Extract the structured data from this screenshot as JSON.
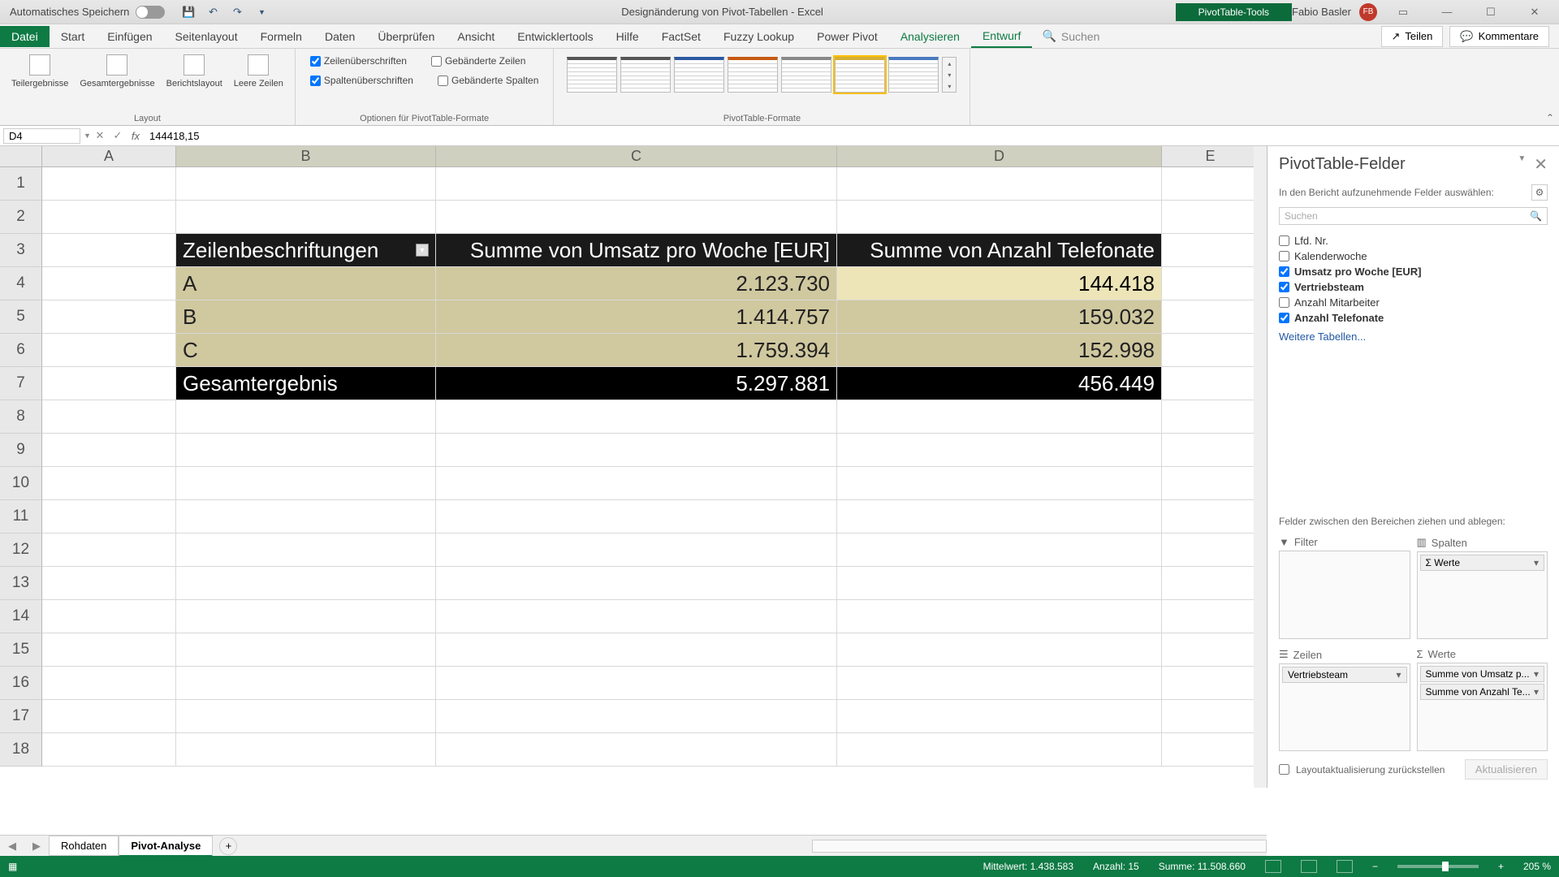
{
  "titlebar": {
    "autosave": "Automatisches Speichern",
    "doc_title": "Designänderung von Pivot-Tabellen - Excel",
    "tools_tab": "PivotTable-Tools",
    "user": "Fabio Basler",
    "user_initials": "FB"
  },
  "ribbon": {
    "tabs": [
      "Datei",
      "Start",
      "Einfügen",
      "Seitenlayout",
      "Formeln",
      "Daten",
      "Überprüfen",
      "Ansicht",
      "Entwicklertools",
      "Hilfe",
      "FactSet",
      "Fuzzy Lookup",
      "Power Pivot",
      "Analysieren",
      "Entwurf"
    ],
    "search_label": "Suchen",
    "share": "Teilen",
    "comments": "Kommentare",
    "layout_group": "Layout",
    "layout_btn1": "Teilergebnisse",
    "layout_btn2": "Gesamtergebnisse",
    "layout_btn3": "Berichtslayout",
    "layout_btn4": "Leere Zeilen",
    "opt_group": "Optionen für PivotTable-Formate",
    "chk_row_hdr": "Zeilenüberschriften",
    "chk_col_hdr": "Spaltenüberschriften",
    "chk_band_rows": "Gebänderte Zeilen",
    "chk_band_cols": "Gebänderte Spalten",
    "styles_group": "PivotTable-Formate"
  },
  "namebox": "D4",
  "formula": "144418,15",
  "columns": {
    "A_w": 165,
    "B_w": 320,
    "C_w": 494,
    "D_w": 400,
    "E_w": 120
  },
  "pivot": {
    "hdr_rows": "Zeilenbeschriftungen",
    "hdr_c": "Summe von Umsatz pro Woche [EUR]",
    "hdr_d": "Summe von Anzahl Telefonate",
    "rows": [
      {
        "label": "A",
        "c": "2.123.730",
        "d": "144.418"
      },
      {
        "label": "B",
        "c": "1.414.757",
        "d": "159.032"
      },
      {
        "label": "C",
        "c": "1.759.394",
        "d": "152.998"
      }
    ],
    "total_label": "Gesamtergebnis",
    "total_c": "5.297.881",
    "total_d": "456.449"
  },
  "fieldpane": {
    "title": "PivotTable-Felder",
    "subtitle": "In den Bericht aufzunehmende Felder auswählen:",
    "search_ph": "Suchen",
    "fields": [
      {
        "checked": false,
        "label": "Lfd. Nr."
      },
      {
        "checked": false,
        "label": "Kalenderwoche"
      },
      {
        "checked": true,
        "label": "Umsatz pro Woche [EUR]"
      },
      {
        "checked": true,
        "label": "Vertriebsteam"
      },
      {
        "checked": false,
        "label": "Anzahl Mitarbeiter"
      },
      {
        "checked": true,
        "label": "Anzahl Telefonate"
      }
    ],
    "more_tables": "Weitere Tabellen...",
    "drag_label": "Felder zwischen den Bereichen ziehen und ablegen:",
    "area_filter": "Filter",
    "area_cols": "Spalten",
    "area_rows": "Zeilen",
    "area_values": "Werte",
    "col_item": "Σ Werte",
    "row_item": "Vertriebsteam",
    "val_item1": "Summe von Umsatz p...",
    "val_item2": "Summe von Anzahl Te...",
    "defer": "Layoutaktualisierung zurückstellen",
    "update": "Aktualisieren"
  },
  "tabs": {
    "t1": "Rohdaten",
    "t2": "Pivot-Analyse"
  },
  "status": {
    "mean_lbl": "Mittelwert:",
    "mean_val": "1.438.583",
    "count_lbl": "Anzahl:",
    "count_val": "15",
    "sum_lbl": "Summe:",
    "sum_val": "11.508.660",
    "zoom": "205 %"
  }
}
